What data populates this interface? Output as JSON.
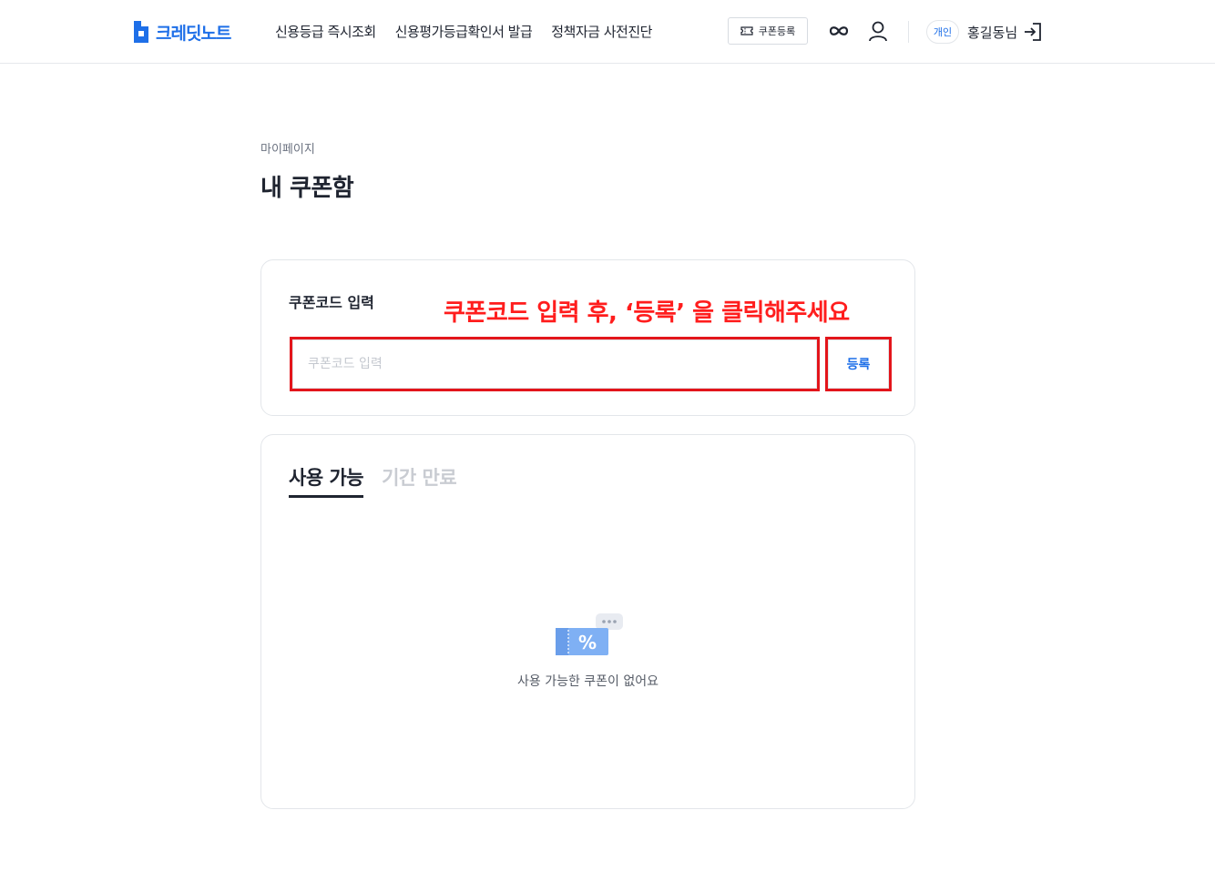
{
  "header": {
    "logo_text": "크레딧노트",
    "nav": [
      {
        "label": "신용등급 즉시조회"
      },
      {
        "label": "신용평가등급확인서 발급"
      },
      {
        "label": "정책자금 사전진단"
      }
    ],
    "coupon_button_label": "쿠폰등록",
    "user_type_badge": "개인",
    "username": "홍길동님",
    "icons": [
      "ticket-icon",
      "infinity-icon",
      "user-icon",
      "logout-icon"
    ]
  },
  "page": {
    "breadcrumb": "마이페이지",
    "title": "내 쿠폰함"
  },
  "coupon_form": {
    "label": "쿠폰코드 입력",
    "annotation": "쿠폰코드 입력 후, ‘등록’ 을 클릭해주세요",
    "input_placeholder": "쿠폰코드 입력",
    "input_value": "",
    "register_label": "등록"
  },
  "coupon_list": {
    "tabs": [
      {
        "label": "사용 가능",
        "active": true
      },
      {
        "label": "기간 만료",
        "active": false
      }
    ],
    "empty_message": "사용 가능한 쿠폰이 없어요"
  },
  "colors": {
    "brand": "#1e6fe8",
    "annotation_red": "#ff1d1d",
    "highlight_border": "#e3151b"
  }
}
